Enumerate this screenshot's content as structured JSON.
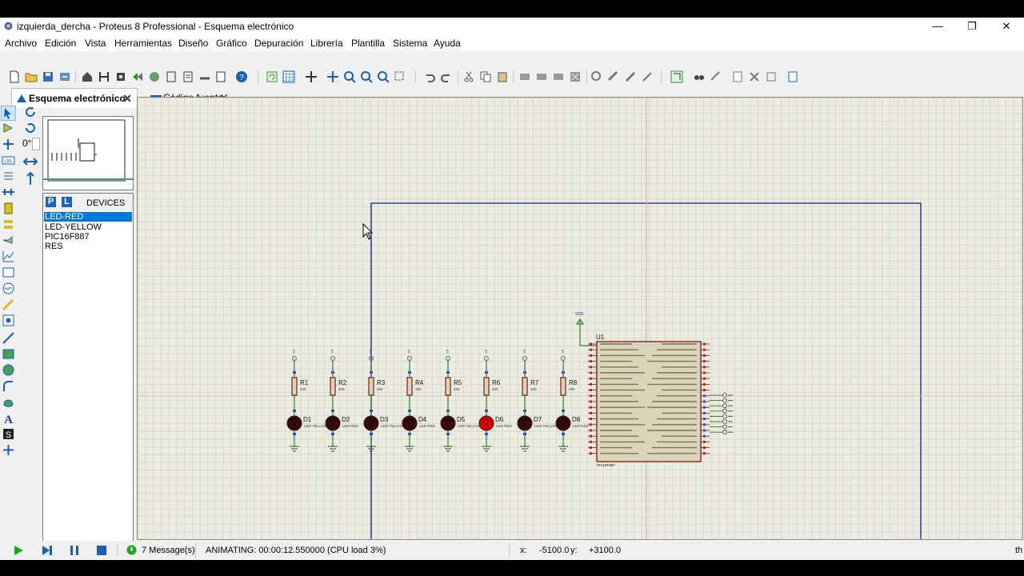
{
  "window": {
    "title": "izquierda_dercha - Proteus 8 Professional - Esquema electrónico"
  },
  "menu": [
    "Archivo",
    "Edición",
    "Vista",
    "Herramientas",
    "Diseño",
    "Gráfico",
    "Depuración",
    "Librería",
    "Plantilla",
    "Sistema",
    "Ayuda"
  ],
  "tabs": [
    {
      "label": "Esquema electrónico",
      "active": true
    },
    {
      "label": "Código fuente",
      "active": false
    }
  ],
  "rotation": {
    "angle": "0°"
  },
  "devices": {
    "p_label": "P",
    "l_label": "L",
    "title": "DEVICES",
    "items": [
      "LED-RED",
      "LED-YELLOW",
      "PIC16F887",
      "RES"
    ],
    "selected": "LED-RED"
  },
  "schematic": {
    "resistors": [
      "R1",
      "R2",
      "R3",
      "R4",
      "R5",
      "R6",
      "R7",
      "R8"
    ],
    "resistor_value": "330",
    "leds": [
      "D1",
      "D2",
      "D3",
      "D4",
      "D5",
      "D6",
      "D7",
      "D8"
    ],
    "led_types": [
      "LED-YELLOW",
      "LED-RED",
      "LED-YELLOW",
      "LED-RED",
      "LED-YELLOW",
      "LED-RED",
      "LED-YELLOW",
      "LED-RED"
    ],
    "led_lit": [
      false,
      false,
      false,
      false,
      false,
      true,
      false,
      false
    ],
    "ic_ref": "U1",
    "ic_name": "PIC16F887",
    "vdd_label": "VDD"
  },
  "status": {
    "messages": "7 Message(s)",
    "state": "ANIMATING: 00:00:12.550000 (CPU load 3%)",
    "x_label": "x:",
    "x_value": "-5100.0",
    "y_label": "y:",
    "y_value": "+3100.0",
    "trailing": "th"
  },
  "colors": {
    "accent": "#0078d7",
    "wire": "#1a1a8c",
    "led_on": "#e00000",
    "led_off": "#3a0a0a",
    "ic_body": "#d9d5b8"
  }
}
